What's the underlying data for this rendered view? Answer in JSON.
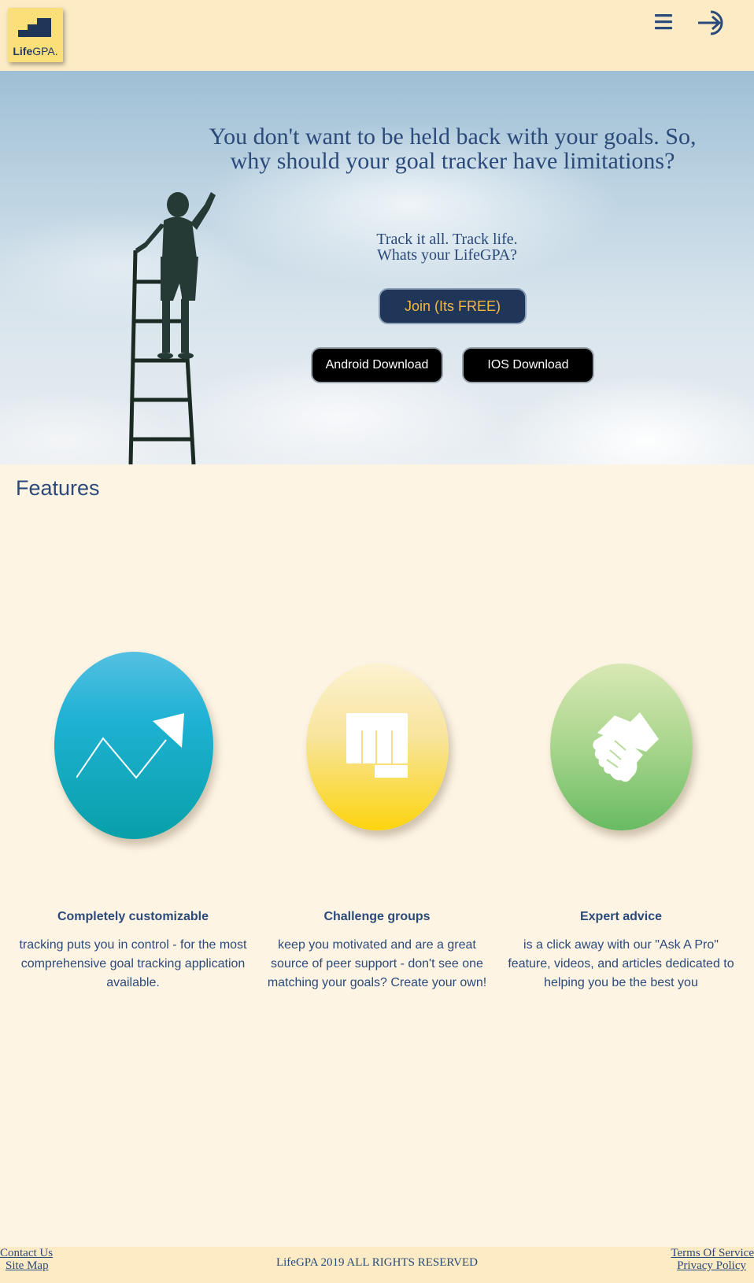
{
  "header": {
    "logo": {
      "brand_bold": "Life",
      "brand_light": "GPA",
      "trademark": "."
    },
    "menu_icon": "hamburger-icon",
    "login_icon": "sign-in-arrow-icon"
  },
  "hero": {
    "headline": "You don't want to be held back with your goals. So, why should your goal tracker have limitations?",
    "sub_line1": "Track it all. Track life.",
    "sub_line2": "Whats your LifeGPA?",
    "join_label": "Join (Its FREE)",
    "android_label": "Android Download",
    "ios_label": "IOS Download"
  },
  "features": {
    "title": "Features",
    "items": [
      {
        "icon": "trend-arrow-icon",
        "title": "Completely customizable",
        "text": "tracking puts you in control - for the most comprehensive goal tracking application available."
      },
      {
        "icon": "fist-icon",
        "title": "Challenge groups",
        "text": "keep you motivated and are a great source of peer support - don't see one matching your goals? Create your own!"
      },
      {
        "icon": "handshake-icon",
        "title": "Expert advice",
        "text": "is a click away with our \"Ask A Pro\" feature, videos, and articles dedicated to helping you be the best you"
      }
    ]
  },
  "footer": {
    "contact": "Contact Us",
    "sitemap": "Site Map",
    "copyright": "LifeGPA 2019 ALL RIGHTS RESERVED",
    "terms": "Terms Of Service",
    "privacy": "Privacy Policy"
  },
  "colors": {
    "page_bg": "#fdf4e4",
    "header_bg": "#fcebc4",
    "text_navy": "#2b4a7a",
    "join_bg": "#1f3659",
    "join_text": "#f5b942",
    "logo_bg": "#fbe07a"
  }
}
